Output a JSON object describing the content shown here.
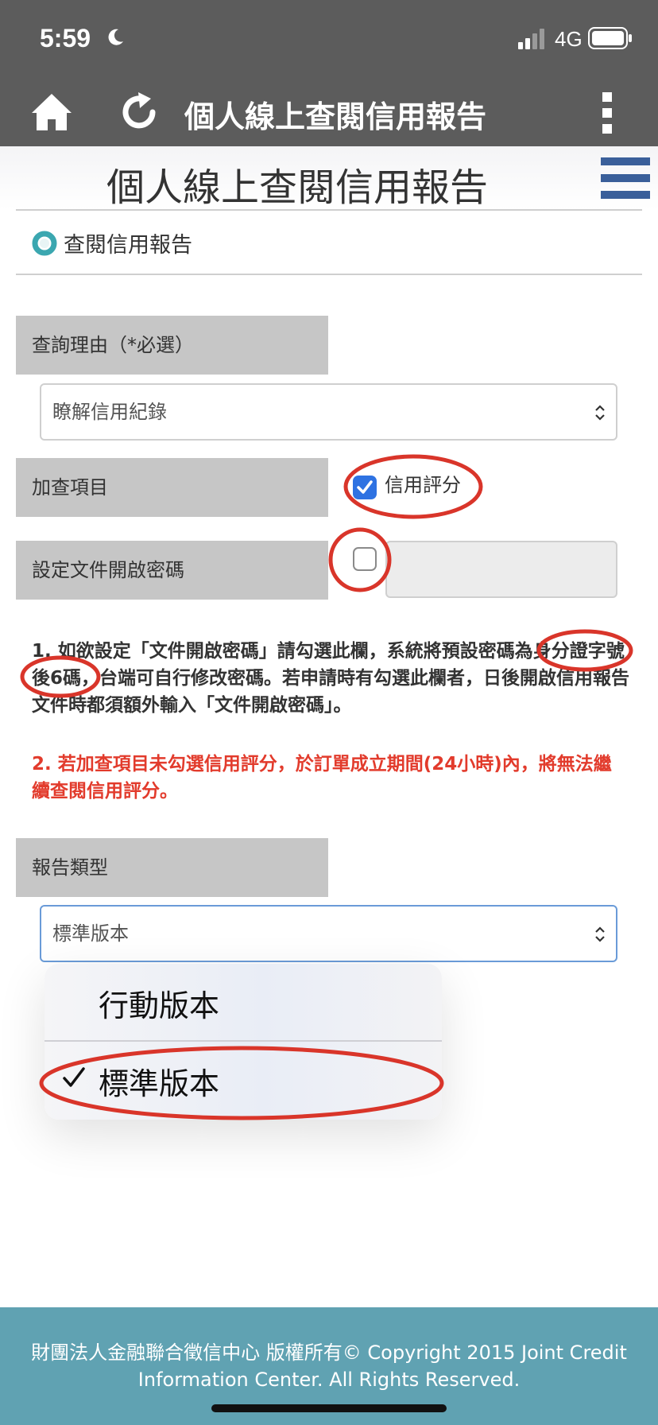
{
  "status_bar": {
    "time": "5:59",
    "network": "4G"
  },
  "toolbar": {
    "title": "個人線上查閱信用報告"
  },
  "page": {
    "title": "個人線上查閱信用報告",
    "section": "查閱信用報告"
  },
  "form": {
    "reason": {
      "label": "查詢理由（*必選）",
      "value": "瞭解信用紀錄"
    },
    "extra": {
      "label": "加查項目",
      "option_label": "信用評分",
      "checked": true
    },
    "password": {
      "label": "設定文件開啟密碼",
      "checked": false,
      "value": ""
    },
    "report_type": {
      "label": "報告類型",
      "value": "標準版本"
    }
  },
  "notes": {
    "note1": "1. 如欲設定「文件開啟密碼」請勾選此欄，系統將預設密碼為身分證字號後6碼，台端可自行修改密碼。若申請時有勾選此欄者，日後開啟信用報告文件時都須額外輸入「文件開啟密碼」。",
    "note2": "2. 若加查項目未勾選信用評分，於訂單成立期間(24小時)內，將無法繼續查閱信用評分。"
  },
  "dropdown": {
    "options": [
      {
        "label": "行動版本",
        "selected": false
      },
      {
        "label": "標準版本",
        "selected": true
      }
    ]
  },
  "footer": {
    "text": "財團法人金融聯合徵信中心 版權所有© Copyright 2015 Joint Credit Information Center. All Rights Reserved."
  },
  "colors": {
    "bar": "#5c5c5c",
    "checkbox": "#2e72e2",
    "note_red": "#e23b2c",
    "footer": "#60a2b2",
    "markup": "#d9352a"
  }
}
